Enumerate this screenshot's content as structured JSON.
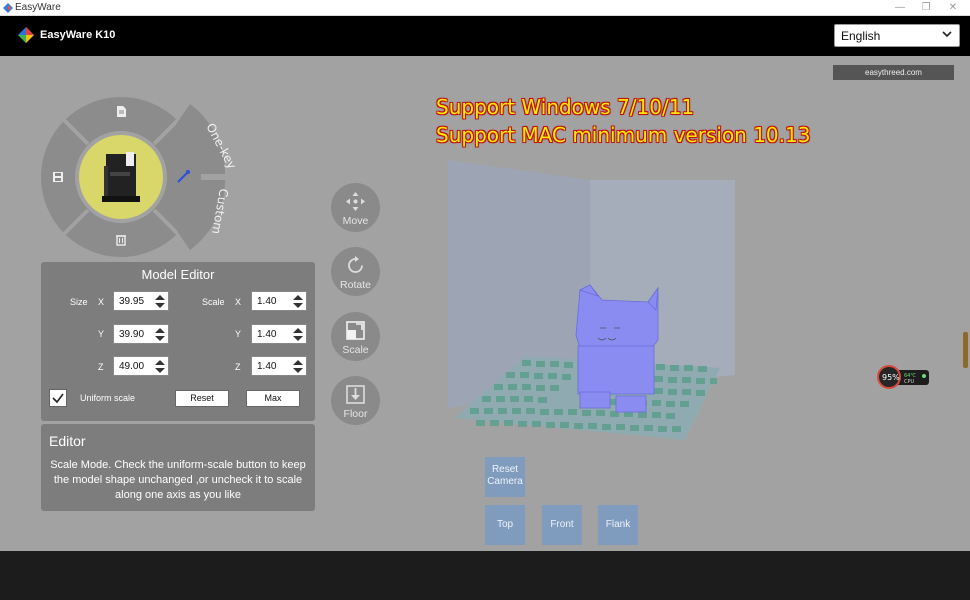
{
  "window": {
    "title": "EasyWare",
    "controls": [
      "—",
      "❐",
      "✕"
    ]
  },
  "header": {
    "brand": "EasyWare K10"
  },
  "language": {
    "selected": "English"
  },
  "url_badge": "easythreed.com",
  "promo": {
    "line1": "Support Windows 7/10/11",
    "line2": "Support MAC minimum version 10.13"
  },
  "ring_menu": {
    "one_key": "One-key",
    "custom": "Custom"
  },
  "model_editor": {
    "title": "Model Editor",
    "size_label": "Size",
    "scale_label": "Scale",
    "axes": [
      "X",
      "Y",
      "Z"
    ],
    "size": {
      "x": "39.95",
      "y": "39.90",
      "z": "49.00"
    },
    "scale": {
      "x": "1.40",
      "y": "1.40",
      "z": "1.40"
    },
    "uniform_scale_label": "Uniform scale",
    "uniform_scale_checked": true,
    "reset_label": "Reset",
    "max_label": "Max"
  },
  "editor": {
    "title": "Editor",
    "description": "Scale Mode. Check the uniform-scale button to keep the model shape unchanged ,or uncheck it to scale along one axis as you like"
  },
  "tools": {
    "move": "Move",
    "rotate": "Rotate",
    "scale": "Scale",
    "floor": "Floor"
  },
  "views": {
    "reset_camera": "Reset Camera",
    "top": "Top",
    "front": "Front",
    "flank": "Flank"
  },
  "widget": {
    "percent": "95%",
    "temp": "64℃",
    "cpu": "CPU"
  },
  "colors": {
    "accent_yellow": "#ffea00",
    "view_button": "#7f9bbd",
    "model": "#8a8cf2"
  }
}
